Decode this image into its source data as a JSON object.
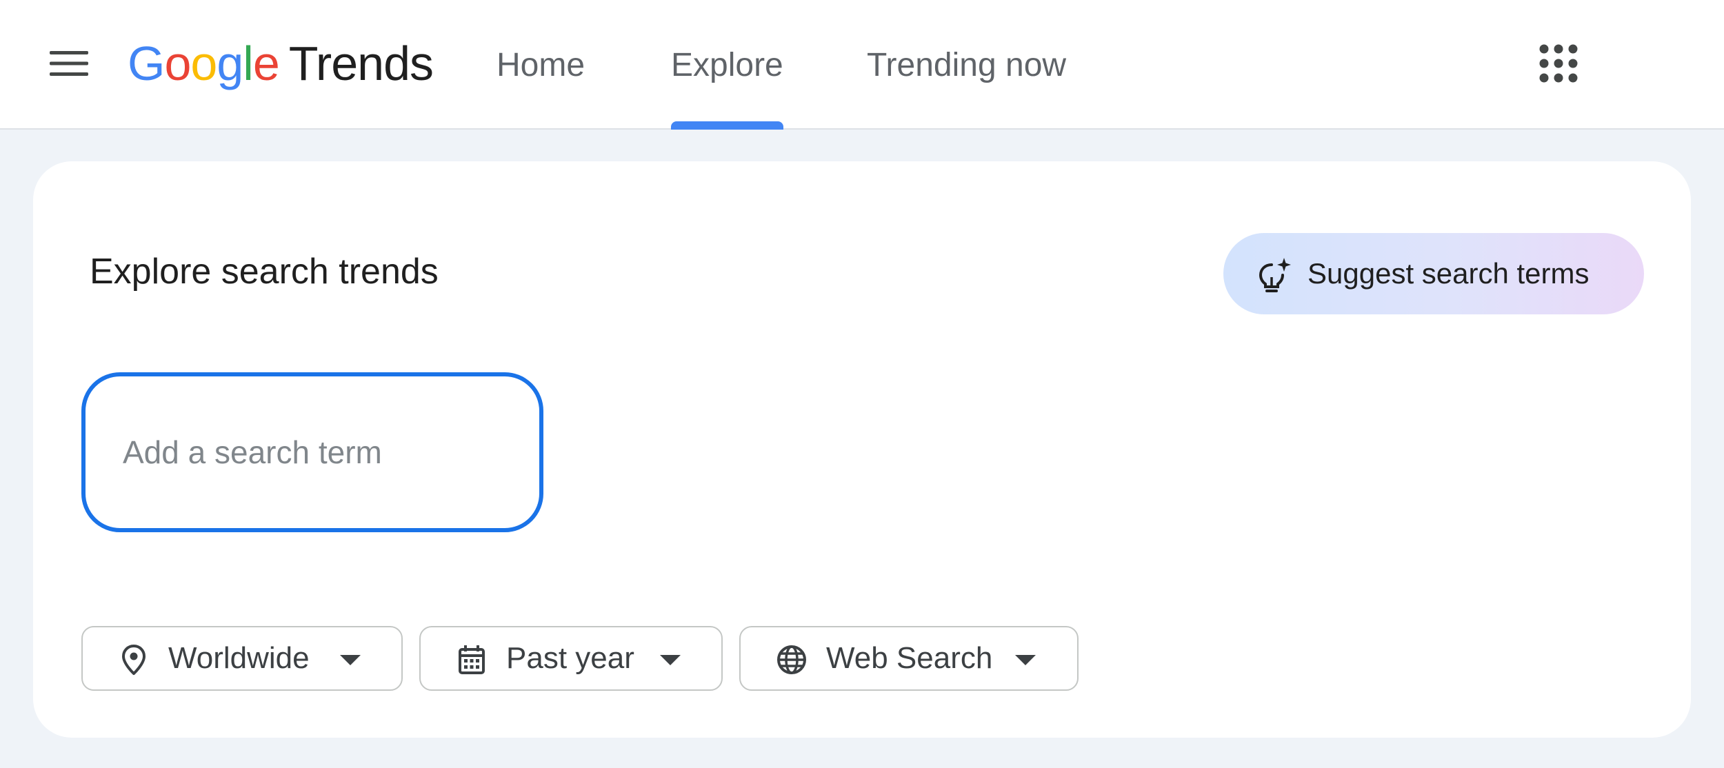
{
  "header": {
    "logo": {
      "letters": [
        "G",
        "o",
        "o",
        "g",
        "l",
        "e"
      ],
      "letter_colors": [
        "#4285f4",
        "#ea4335",
        "#fbbc05",
        "#4285f4",
        "#34a853",
        "#ea4335"
      ],
      "product": "Trends"
    },
    "nav": [
      {
        "label": "Home",
        "active": false
      },
      {
        "label": "Explore",
        "active": true
      },
      {
        "label": "Trending now",
        "active": false
      }
    ],
    "icons": {
      "menu": "hamburger-menu-icon",
      "apps": "apps-grid-icon"
    },
    "accent_color": "#4285f4"
  },
  "card": {
    "title": "Explore search trends",
    "suggest_button": {
      "label": "Suggest search terms",
      "icon": "lightbulb-sparkle-icon"
    },
    "search": {
      "value": "",
      "placeholder": "Add a search term",
      "border_color": "#1a73e8"
    },
    "filters": [
      {
        "label": "Worldwide",
        "icon": "location-pin-icon"
      },
      {
        "label": "Past year",
        "icon": "calendar-icon"
      },
      {
        "label": "Web Search",
        "icon": "globe-icon"
      }
    ]
  }
}
